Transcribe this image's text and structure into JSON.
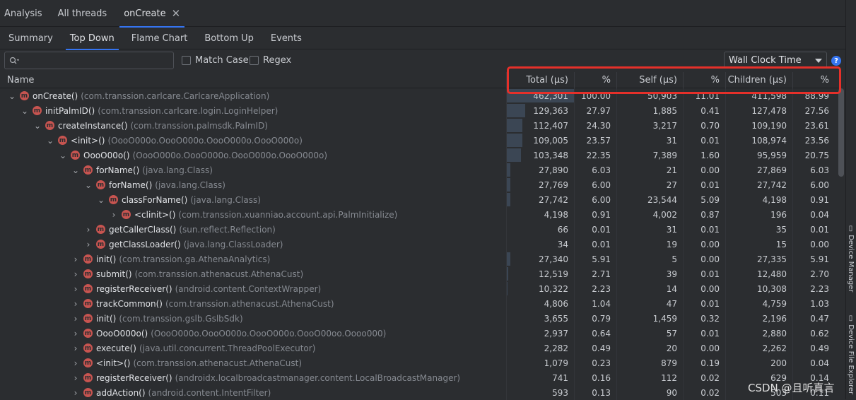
{
  "tabs": {
    "analysis": "Analysis",
    "all_threads": "All threads",
    "oncreate": "onCreate",
    "close": "✕"
  },
  "subtabs": [
    "Summary",
    "Top Down",
    "Flame Chart",
    "Bottom Up",
    "Events"
  ],
  "filter": {
    "search_placeholder": "Q",
    "match_case": "Match Case",
    "regex": "Regex",
    "clock": "Wall Clock Time",
    "help": "?"
  },
  "columns": {
    "name": "Name",
    "total": "Total (μs)",
    "total_pct": "%",
    "self": "Self (μs)",
    "self_pct": "%",
    "children": "Children (μs)",
    "children_pct": "%"
  },
  "rows": [
    {
      "exp": "⌄",
      "method": "onCreate()",
      "cls": "(com.transsion.carlcare.CarlcareApplication)",
      "total": "462,301",
      "tp": "100.00",
      "self": "50,903",
      "sp": "11.01",
      "children": "411,598",
      "cp": "88.99"
    },
    {
      "exp": "⌄",
      "method": "initPalmID()",
      "cls": "(com.transsion.carlcare.login.LoginHelper)",
      "total": "129,363",
      "tp": "27.97",
      "self": "1,885",
      "sp": "0.41",
      "children": "127,478",
      "cp": "27.56"
    },
    {
      "exp": "⌄",
      "method": "createInstance()",
      "cls": "(com.transsion.palmsdk.PalmID)",
      "total": "112,407",
      "tp": "24.30",
      "self": "3,217",
      "sp": "0.70",
      "children": "109,190",
      "cp": "23.61"
    },
    {
      "exp": "⌄",
      "method": "<init>()",
      "cls": "(OooO000o.OooO000o.OooO000o.OooO000o)",
      "total": "109,005",
      "tp": "23.57",
      "self": "31",
      "sp": "0.01",
      "children": "108,974",
      "cp": "23.56"
    },
    {
      "exp": "⌄",
      "method": "OooO00o()",
      "cls": "(OooO000o.OooO000o.OooO000o.OooO000o)",
      "total": "103,348",
      "tp": "22.35",
      "self": "7,389",
      "sp": "1.60",
      "children": "95,959",
      "cp": "20.75"
    },
    {
      "exp": "⌄",
      "method": "forName()",
      "cls": "(java.lang.Class)",
      "total": "27,890",
      "tp": "6.03",
      "self": "21",
      "sp": "0.00",
      "children": "27,869",
      "cp": "6.03"
    },
    {
      "exp": "⌄",
      "method": "forName()",
      "cls": "(java.lang.Class)",
      "total": "27,769",
      "tp": "6.00",
      "self": "27",
      "sp": "0.01",
      "children": "27,742",
      "cp": "6.00"
    },
    {
      "exp": "⌄",
      "method": "classForName()",
      "cls": "(java.lang.Class)",
      "total": "27,742",
      "tp": "6.00",
      "self": "23,544",
      "sp": "5.09",
      "children": "4,198",
      "cp": "0.91"
    },
    {
      "exp": "›",
      "method": "<clinit>()",
      "cls": "(com.transsion.xuanniao.account.api.PalmInitialize)",
      "total": "4,198",
      "tp": "0.91",
      "self": "4,002",
      "sp": "0.87",
      "children": "196",
      "cp": "0.04"
    },
    {
      "exp": "›",
      "method": "getCallerClass()",
      "cls": "(sun.reflect.Reflection)",
      "total": "66",
      "tp": "0.01",
      "self": "31",
      "sp": "0.01",
      "children": "35",
      "cp": "0.01"
    },
    {
      "exp": "›",
      "method": "getClassLoader()",
      "cls": "(java.lang.ClassLoader)",
      "total": "34",
      "tp": "0.01",
      "self": "19",
      "sp": "0.00",
      "children": "15",
      "cp": "0.00"
    },
    {
      "exp": "›",
      "method": "init()",
      "cls": "(com.transsion.ga.AthenaAnalytics)",
      "total": "27,340",
      "tp": "5.91",
      "self": "5",
      "sp": "0.00",
      "children": "27,335",
      "cp": "5.91"
    },
    {
      "exp": "›",
      "method": "submit()",
      "cls": "(com.transsion.athenacust.AthenaCust)",
      "total": "12,519",
      "tp": "2.71",
      "self": "39",
      "sp": "0.01",
      "children": "12,480",
      "cp": "2.70"
    },
    {
      "exp": "›",
      "method": "registerReceiver()",
      "cls": "(android.content.ContextWrapper)",
      "total": "10,322",
      "tp": "2.23",
      "self": "14",
      "sp": "0.00",
      "children": "10,308",
      "cp": "2.23"
    },
    {
      "exp": "›",
      "method": "trackCommon()",
      "cls": "(com.transsion.athenacust.AthenaCust)",
      "total": "4,806",
      "tp": "1.04",
      "self": "47",
      "sp": "0.01",
      "children": "4,759",
      "cp": "1.03"
    },
    {
      "exp": "›",
      "method": "init()",
      "cls": "(com.transsion.gslb.GslbSdk)",
      "total": "3,655",
      "tp": "0.79",
      "self": "1,459",
      "sp": "0.32",
      "children": "2,196",
      "cp": "0.47"
    },
    {
      "exp": "›",
      "method": "OooO000o()",
      "cls": "(OooO000o.OooO000o.OooO000o.OooO00oo.Oooo000)",
      "total": "2,937",
      "tp": "0.64",
      "self": "57",
      "sp": "0.01",
      "children": "2,880",
      "cp": "0.62"
    },
    {
      "exp": "›",
      "method": "execute()",
      "cls": "(java.util.concurrent.ThreadPoolExecutor)",
      "total": "2,282",
      "tp": "0.49",
      "self": "20",
      "sp": "0.00",
      "children": "2,262",
      "cp": "0.49"
    },
    {
      "exp": "›",
      "method": "<init>()",
      "cls": "(com.transsion.athenacust.AthenaCust)",
      "total": "1,079",
      "tp": "0.23",
      "self": "879",
      "sp": "0.19",
      "children": "200",
      "cp": "0.04"
    },
    {
      "exp": "›",
      "method": "registerReceiver()",
      "cls": "(androidx.localbroadcastmanager.content.LocalBroadcastManager)",
      "total": "741",
      "tp": "0.16",
      "self": "112",
      "sp": "0.02",
      "children": "629",
      "cp": "0.14"
    },
    {
      "exp": "›",
      "method": "addAction()",
      "cls": "(android.content.IntentFilter)",
      "total": "593",
      "tp": "0.13",
      "self": "90",
      "sp": "0.02",
      "children": "503",
      "cp": "0.11"
    }
  ],
  "row_depths": [
    0,
    1,
    2,
    3,
    4,
    5,
    6,
    7,
    8,
    6,
    6,
    5,
    5,
    5,
    5,
    5,
    5,
    5,
    5,
    5,
    5
  ],
  "icon_letter": "m",
  "right_strip": {
    "device_manager": "Device Manager",
    "device_file_explorer": "Device File Explorer"
  },
  "watermark": "CSDN @且听真言",
  "colors": {
    "accent": "#3574f0",
    "highlight_box": "#e5302a",
    "method_icon": "#c75450",
    "bar": "#3b4654"
  }
}
